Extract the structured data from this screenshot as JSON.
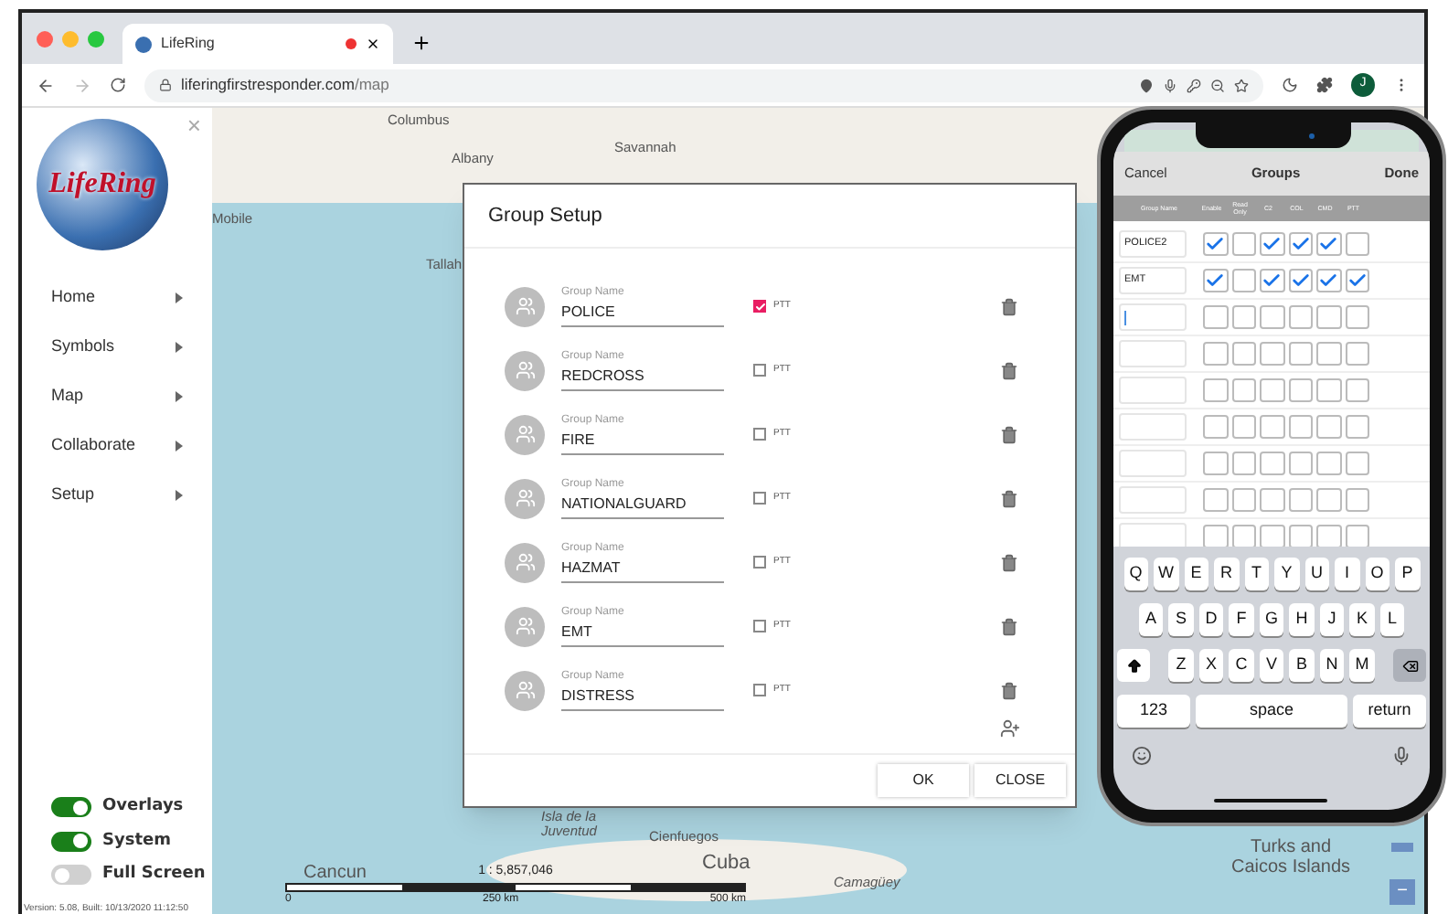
{
  "browser": {
    "tab_title": "LifeRing",
    "url_host": "liferingfirstresponder.com",
    "url_path": "/map",
    "profile_initial": "J"
  },
  "sidebar": {
    "logo_text": "LifeRing",
    "close": "×",
    "menu": [
      {
        "label": "Home"
      },
      {
        "label": "Symbols"
      },
      {
        "label": "Map"
      },
      {
        "label": "Collaborate"
      },
      {
        "label": "Setup"
      }
    ],
    "toggles": [
      {
        "label": "Overlays",
        "on": true
      },
      {
        "label": "System",
        "on": true
      },
      {
        "label": "Full Screen",
        "on": false
      }
    ],
    "version": "Version: 5.08, Built: 10/13/2020 11:12:50"
  },
  "map": {
    "labels": [
      "Columbus",
      "Albany",
      "Savannah",
      "Mobile",
      "Tallah",
      "Isla de la Juventud",
      "Cienfuegos",
      "Cuba",
      "Camagüey",
      "Cancun",
      "Turks and Caicos Islands"
    ],
    "scale": {
      "ratio": "1 : 5,857,046",
      "ticks": [
        "0",
        "250 km",
        "500 km"
      ]
    },
    "zoom_out": "−"
  },
  "dialog": {
    "title": "Group Setup",
    "groups": [
      {
        "field_label": "Group Name",
        "name": "POLICE",
        "ptt_label": "PTT",
        "ptt": true
      },
      {
        "field_label": "Group Name",
        "name": "REDCROSS",
        "ptt_label": "PTT",
        "ptt": false
      },
      {
        "field_label": "Group Name",
        "name": "FIRE",
        "ptt_label": "PTT",
        "ptt": false
      },
      {
        "field_label": "Group Name",
        "name": "NATIONALGUARD",
        "ptt_label": "PTT",
        "ptt": false
      },
      {
        "field_label": "Group Name",
        "name": "HAZMAT",
        "ptt_label": "PTT",
        "ptt": false
      },
      {
        "field_label": "Group Name",
        "name": "EMT",
        "ptt_label": "PTT",
        "ptt": false
      },
      {
        "field_label": "Group Name",
        "name": "DISTRESS",
        "ptt_label": "PTT",
        "ptt": false
      }
    ],
    "buttons": [
      "OK",
      "CLOSE"
    ]
  },
  "phone": {
    "cancel": "Cancel",
    "title": "Groups",
    "done": "Done",
    "columns": [
      "Group Name",
      "Enable",
      "Read Only",
      "C2",
      "COL",
      "CMD",
      "PTT"
    ],
    "rows": [
      {
        "name": "POLICE2",
        "flags": [
          true,
          false,
          true,
          true,
          true,
          false
        ]
      },
      {
        "name": "EMT",
        "flags": [
          true,
          false,
          true,
          true,
          true,
          true
        ]
      },
      {
        "focused": true,
        "flags": [
          false,
          false,
          false,
          false,
          false,
          false
        ]
      },
      {
        "flags": [
          false,
          false,
          false,
          false,
          false,
          false
        ]
      },
      {
        "flags": [
          false,
          false,
          false,
          false,
          false,
          false
        ]
      },
      {
        "flags": [
          false,
          false,
          false,
          false,
          false,
          false
        ]
      },
      {
        "flags": [
          false,
          false,
          false,
          false,
          false,
          false
        ]
      },
      {
        "flags": [
          false,
          false,
          false,
          false,
          false,
          false
        ]
      },
      {
        "flags": [
          false,
          false,
          false,
          false,
          false,
          false
        ]
      }
    ],
    "keyboard": {
      "rows": [
        [
          "Q",
          "W",
          "E",
          "R",
          "T",
          "Y",
          "U",
          "I",
          "O",
          "P"
        ],
        [
          "A",
          "S",
          "D",
          "F",
          "G",
          "H",
          "J",
          "K",
          "L"
        ],
        [
          "Z",
          "X",
          "C",
          "V",
          "B",
          "N",
          "M"
        ]
      ],
      "numbers": "123",
      "space": "space",
      "return": "return"
    }
  }
}
